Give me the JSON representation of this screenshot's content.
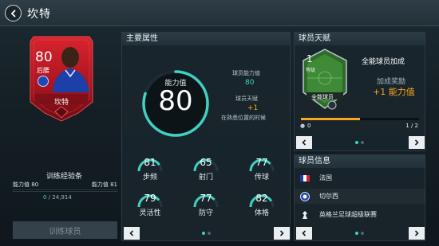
{
  "header": {
    "title": "坎特"
  },
  "card": {
    "rating": "80",
    "position": "后腰",
    "name": "坎特"
  },
  "training": {
    "label": "训练经验条",
    "left_label": "能力值",
    "left_value": "80",
    "right_label": "能力值",
    "right_value": "81",
    "progress_current": "0",
    "progress_total": "/ 24,914",
    "button": "训练球员"
  },
  "attributes": {
    "title": "主要属性",
    "overall_label": "能力值",
    "overall_value": "80",
    "player_rating_label": "球员能力值",
    "player_rating_value": "80",
    "talent_label": "球员天赋",
    "talent_value": "+1",
    "talent_note": "在熟悉位置的时候",
    "stats": [
      {
        "value": "81",
        "name": "步频"
      },
      {
        "value": "65",
        "name": "射门"
      },
      {
        "value": "77",
        "name": "传球"
      },
      {
        "value": "79",
        "name": "灵活性"
      },
      {
        "value": "77",
        "name": "防守"
      },
      {
        "value": "82",
        "name": "体格"
      }
    ]
  },
  "talent": {
    "title": "球员天赋",
    "level_num": "1",
    "level_label": "等级",
    "badge_label": "全能球员",
    "bonus_title": "全能球员加成",
    "reward_label": "加成奖励",
    "reward_value": "+1 能力值",
    "progress_left": "0",
    "progress_right": "1 / 2",
    "progress_fraction": 0.5
  },
  "info": {
    "title": "球员信息",
    "nation": "法国",
    "club": "切尔西",
    "league": "英格兰足球超级联赛"
  },
  "colors": {
    "accent": "#3fd1c1",
    "highlight": "#f5a623",
    "card": "#b3192a"
  }
}
